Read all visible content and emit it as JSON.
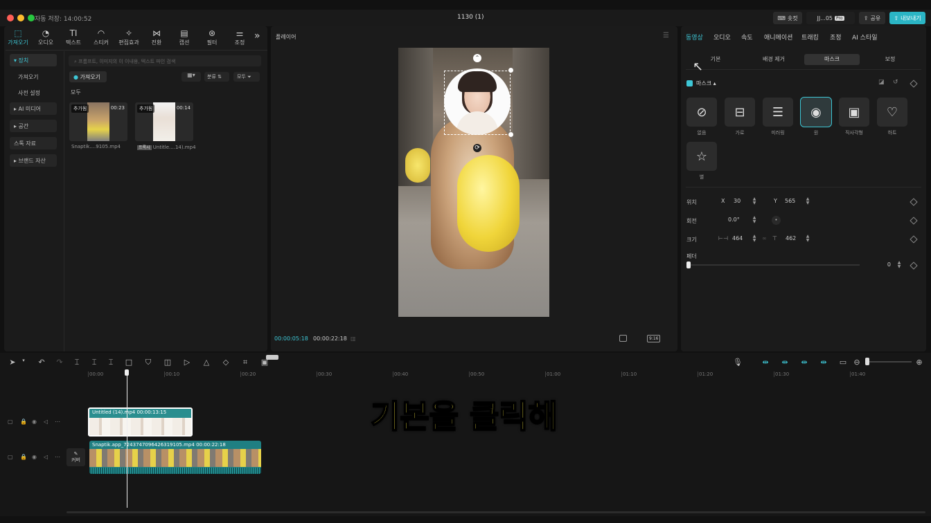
{
  "window": {
    "autosave": "자동 저장: 14:00:52",
    "title": "1130 (1)",
    "shortcut_label": "숏컷",
    "user_label": "JJ...05",
    "pro_badge": "Pro",
    "share_label": "공유",
    "export_label": "내보내기"
  },
  "toolbar": [
    {
      "name": "import",
      "label": "가져오기",
      "icon": "import-icon",
      "glyph": "⬚"
    },
    {
      "name": "audio",
      "label": "오디오",
      "icon": "audio-icon",
      "glyph": "◔"
    },
    {
      "name": "text",
      "label": "텍스트",
      "icon": "text-icon",
      "glyph": "TI"
    },
    {
      "name": "sticker",
      "label": "스티커",
      "icon": "sticker-icon",
      "glyph": "◠"
    },
    {
      "name": "effects",
      "label": "편집효과",
      "icon": "effects-icon",
      "glyph": "✧"
    },
    {
      "name": "transition",
      "label": "전환",
      "icon": "transition-icon",
      "glyph": "⋈"
    },
    {
      "name": "captions",
      "label": "캡션",
      "icon": "captions-icon",
      "glyph": "▤"
    },
    {
      "name": "filter",
      "label": "필터",
      "icon": "filter-icon",
      "glyph": "⊛"
    },
    {
      "name": "adjust",
      "label": "조정",
      "icon": "adjust-icon",
      "glyph": "⚌"
    }
  ],
  "media_sidebar": [
    {
      "label": "▾ 장치"
    },
    {
      "label": "가져오기"
    },
    {
      "label": "사전 설정"
    },
    {
      "label": "▸ AI 미디어"
    },
    {
      "label": "▸ 공간"
    },
    {
      "label": "스톡 자료"
    },
    {
      "label": "▸ 브랜드 자산"
    }
  ],
  "media": {
    "search_placeholder": "프롬프트, 이미지의 이 이내용, 텍스트 파인 검색",
    "import_button": "가져오기",
    "sort_label": "분류",
    "filter_label": "모두",
    "section_all": "모두",
    "clips": [
      {
        "badge": "추가됨",
        "duration": "00:23",
        "caption": "Snaptik....9105.mp4"
      },
      {
        "badge": "추가됨",
        "duration": "00:14",
        "caption": "Untitle....14).mp4",
        "tag": "프록시"
      }
    ]
  },
  "player": {
    "title": "플레이어",
    "current_time": "00:00:05:18",
    "total_time": "00:00:22:18",
    "ratio_label": "9:16"
  },
  "inspector": {
    "tabs": [
      "동영상",
      "오디오",
      "속도",
      "애니메이션",
      "트래킹",
      "조정",
      "AI 스타일"
    ],
    "subtabs": [
      "기본",
      "배경 제거",
      "마스크",
      "보정"
    ],
    "mask_section": "마스크",
    "shapes": [
      {
        "label": "없음",
        "icon": "none-icon"
      },
      {
        "label": "가로",
        "icon": "horizontal-icon"
      },
      {
        "label": "미러링",
        "icon": "mirror-icon"
      },
      {
        "label": "원",
        "icon": "circle-icon"
      },
      {
        "label": "직사각형",
        "icon": "rectangle-icon"
      },
      {
        "label": "하트",
        "icon": "heart-icon"
      },
      {
        "label": "별",
        "icon": "star-icon"
      }
    ],
    "position_label": "위치",
    "x_label": "X",
    "x_value": "30",
    "y_label": "Y",
    "y_value": "565",
    "rotation_label": "회전",
    "rotation_value": "0.0°",
    "size_label": "크기",
    "width_value": "464",
    "height_value": "462",
    "feather_label": "페더",
    "feather_value": "0"
  },
  "timeline": {
    "ruler": [
      "00:00",
      "00:10",
      "00:20",
      "00:30",
      "00:40",
      "00:50",
      "01:00",
      "01:10",
      "01:20",
      "01:30",
      "01:40"
    ],
    "clip1": {
      "name": "Untitled (14).mp4",
      "duration": "00:00:13:15"
    },
    "clip2": {
      "name": "Snaptik.app_7243747096426319105.mp4",
      "duration": "00:00:22:18"
    },
    "cover_label": "커버",
    "playhead_fraction": 0.045
  },
  "subtitle_overlay": "기본을 클릭해",
  "colors": {
    "accent": "#3ec7d6",
    "subtitle": "#f5e642"
  }
}
